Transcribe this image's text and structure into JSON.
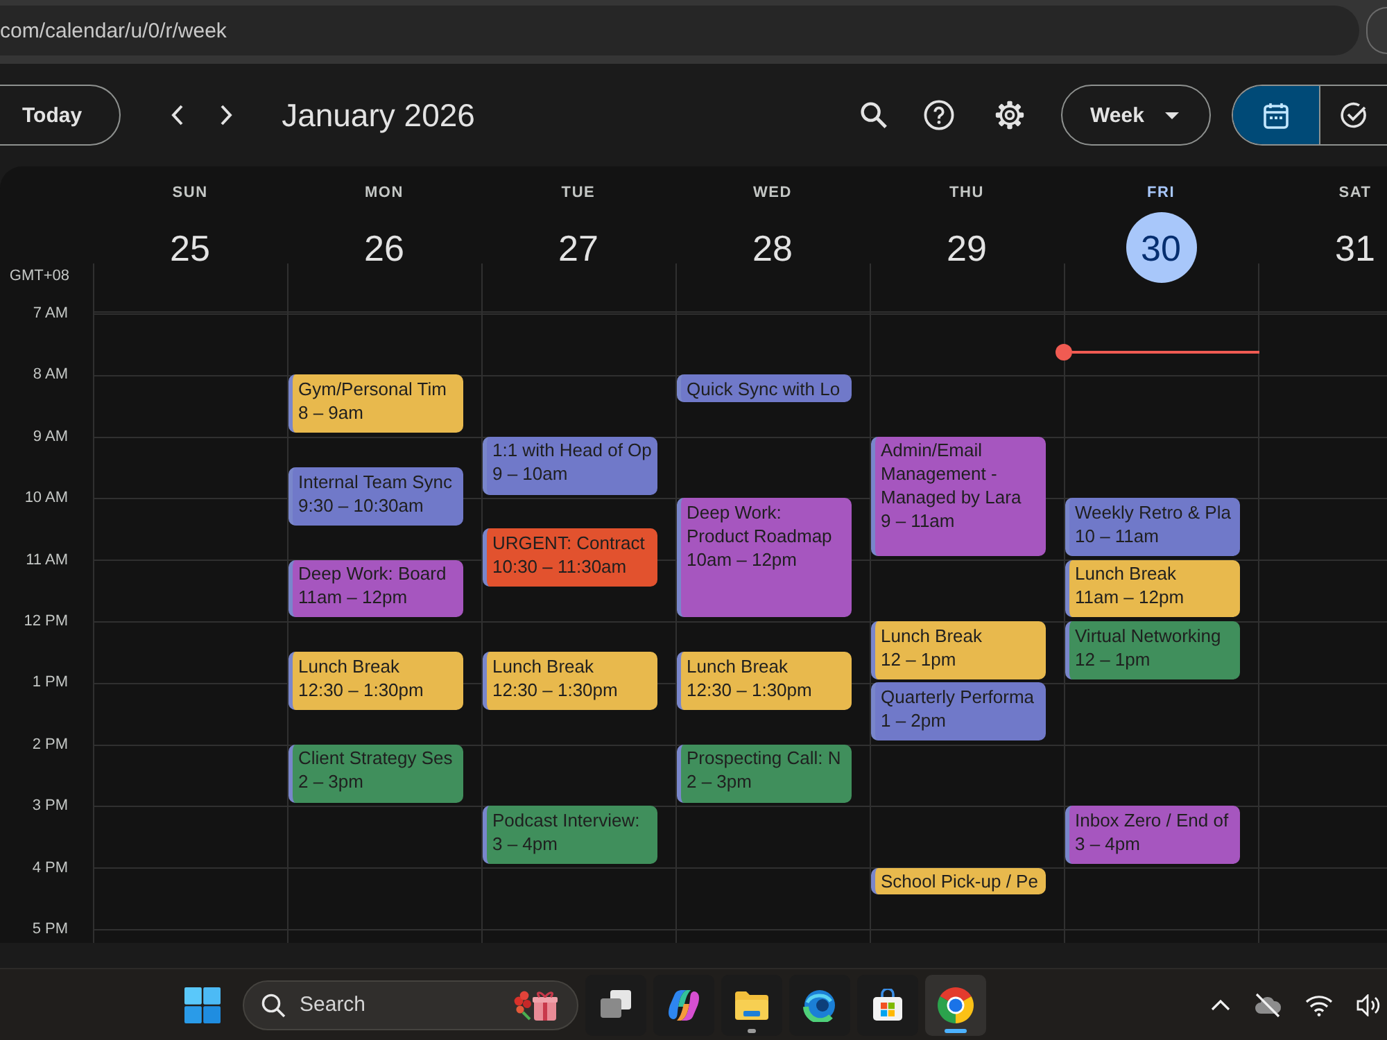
{
  "browser": {
    "url": "com/calendar/u/0/r/week"
  },
  "toolbar": {
    "today_button": "Today",
    "title": "January 2026",
    "view_select": "Week",
    "view_toggle": [
      {
        "kind": "calendar",
        "selected": true
      },
      {
        "kind": "tasks",
        "selected": false
      }
    ]
  },
  "week": {
    "timezone": "GMT+08",
    "hours": [
      "7 AM",
      "8 AM",
      "9 AM",
      "10 AM",
      "11 AM",
      "12 PM",
      "1 PM",
      "2 PM",
      "3 PM",
      "4 PM",
      "5 PM"
    ],
    "days": [
      {
        "name": "SUN",
        "date": "25",
        "today": false
      },
      {
        "name": "MON",
        "date": "26",
        "today": false,
        "events": [
          {
            "title": "Gym/Personal Tim",
            "time": "8 – 9am",
            "color": "#e8b94d"
          },
          {
            "title": "Internal Team Sync",
            "time": "9:30 – 10:30am",
            "color": "#7079c9"
          },
          {
            "title": "Deep Work: Board",
            "time": "11am – 12pm",
            "color": "#a656bf"
          },
          {
            "title": "Lunch Break",
            "time": "12:30 – 1:30pm",
            "color": "#e8b94d"
          },
          {
            "title": "Client Strategy Ses",
            "time": "2 – 3pm",
            "color": "#408f5c"
          }
        ]
      },
      {
        "name": "TUE",
        "date": "27",
        "today": false,
        "events": [
          {
            "title": "1:1 with Head of Op",
            "time": "9 – 10am",
            "color": "#7079c9"
          },
          {
            "title": "URGENT: Contract",
            "time": "10:30 – 11:30am",
            "color": "#e2522e"
          },
          {
            "title": "Lunch Break",
            "time": "12:30 – 1:30pm",
            "color": "#e8b94d"
          },
          {
            "title": "Podcast Interview:",
            "time": "3 – 4pm",
            "color": "#408f5c"
          }
        ]
      },
      {
        "name": "WED",
        "date": "28",
        "today": false,
        "events": [
          {
            "title": "Quick Sync with Lo",
            "color": "#7079c9"
          },
          {
            "title": "Deep Work: Product Roadmap",
            "time": "10am – 12pm",
            "color": "#a656bf"
          },
          {
            "title": "Lunch Break",
            "time": "12:30 – 1:30pm",
            "color": "#e8b94d"
          },
          {
            "title": "Prospecting Call: N",
            "time": "2 – 3pm",
            "color": "#408f5c"
          }
        ]
      },
      {
        "name": "THU",
        "date": "29",
        "today": false,
        "events": [
          {
            "title": "Admin/Email Management - Managed by Lara",
            "time": "9 – 11am",
            "color": "#a656bf"
          },
          {
            "title": "Lunch Break",
            "time": "12 – 1pm",
            "color": "#e8b94d"
          },
          {
            "title": "Quarterly Performa",
            "time": "1 – 2pm",
            "color": "#7079c9"
          },
          {
            "title": "School Pick-up / Pe",
            "color": "#e8b94d"
          }
        ]
      },
      {
        "name": "FRI",
        "date": "30",
        "today": true,
        "events": [
          {
            "title": "Weekly Retro & Pla",
            "time": "10 – 11am",
            "color": "#7079c9"
          },
          {
            "title": "Lunch Break",
            "time": "11am – 12pm",
            "color": "#e8b94d"
          },
          {
            "title": "Virtual Networking",
            "time": "12 – 1pm",
            "color": "#408f5c"
          },
          {
            "title": "Inbox Zero / End of",
            "time": "3 – 4pm",
            "color": "#a656bf"
          }
        ]
      },
      {
        "name": "SAT",
        "date": "31",
        "today": false
      }
    ]
  },
  "taskbar": {
    "search": {
      "placeholder": "Search"
    },
    "apps": [
      {
        "kind": "taskview",
        "running": false,
        "active": false
      },
      {
        "kind": "assistant",
        "running": false,
        "active": false
      },
      {
        "kind": "files",
        "running": true,
        "active": false
      },
      {
        "kind": "edge",
        "running": false,
        "active": false
      },
      {
        "kind": "store",
        "running": false,
        "active": false
      },
      {
        "kind": "chrome",
        "running": true,
        "active": true
      }
    ]
  }
}
